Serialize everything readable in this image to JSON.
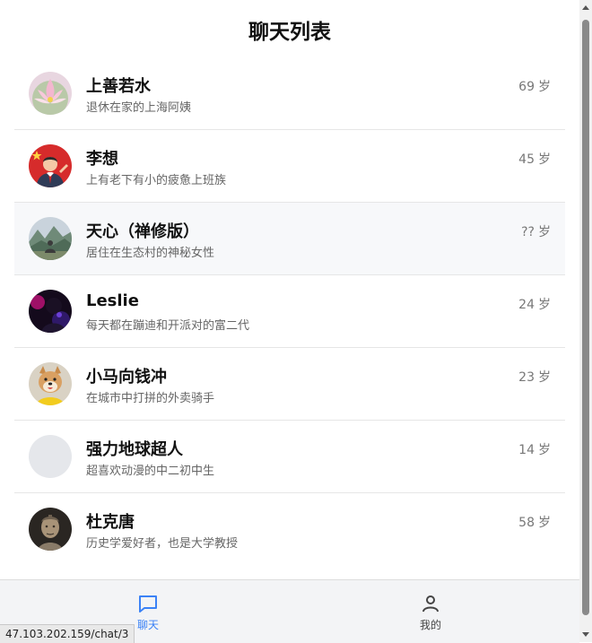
{
  "header": {
    "title": "聊天列表"
  },
  "age_unit": "岁",
  "contacts": [
    {
      "name": "上善若水",
      "bio": "退休在家的上海阿姨",
      "age": "69",
      "avatar": "lotus-avatar"
    },
    {
      "name": "李想",
      "bio": "上有老下有小的疲惫上班族",
      "age": "45",
      "avatar": "office-worker-avatar"
    },
    {
      "name": "天心（禅修版）",
      "bio": "居住在生态村的神秘女性",
      "age": "??",
      "avatar": "mountain-meditation-avatar"
    },
    {
      "name": "Leslie",
      "bio": "每天都在蹦迪和开派对的富二代",
      "age": "24",
      "avatar": "party-avatar"
    },
    {
      "name": "小马向钱冲",
      "bio": "在城市中打拼的外卖骑手",
      "age": "23",
      "avatar": "shiba-dog-avatar"
    },
    {
      "name": "强力地球超人",
      "bio": "超喜欢动漫的中二初中生",
      "age": "14",
      "avatar": "blank-avatar"
    },
    {
      "name": "杜克唐",
      "bio": "历史学爱好者，也是大学教授",
      "age": "58",
      "avatar": "terracotta-warrior-avatar"
    }
  ],
  "tabbar": {
    "chat_label": "聊天",
    "me_label": "我的"
  },
  "status_url": "47.103.202.159/chat/3",
  "colors": {
    "accent": "#3b82f6",
    "active_row": "#f7f8fa"
  }
}
